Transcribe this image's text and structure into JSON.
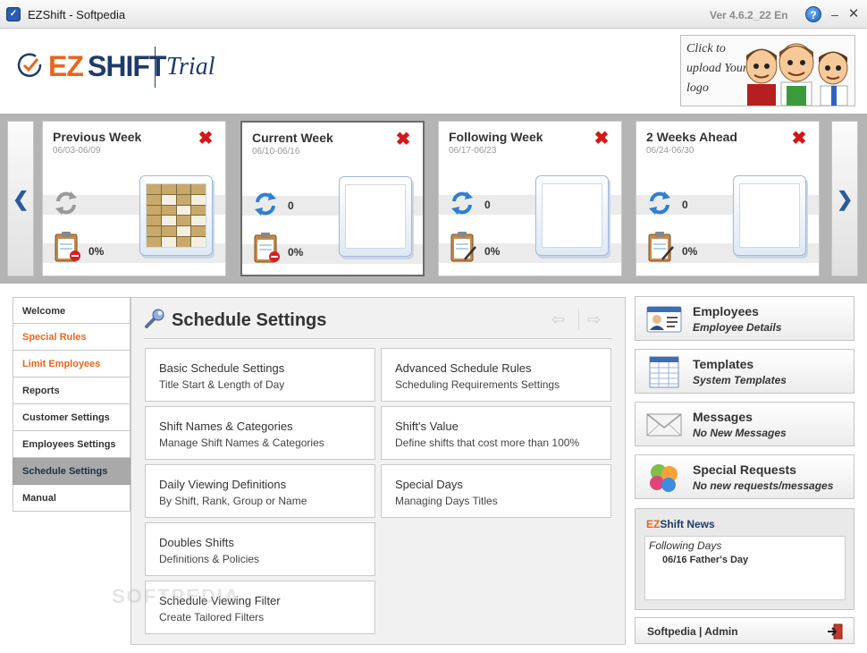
{
  "window": {
    "title": "EZShift - Softpedia",
    "version": "Ver 4.6.2_22 En",
    "help_glyph": "?",
    "minimize_glyph": "–",
    "close_glyph": "✕"
  },
  "header": {
    "logo_ez": "EZ",
    "logo_shift": "SHIFT",
    "logo_trial": "Trial",
    "upload_text": "Click to upload Your logo"
  },
  "weeks": [
    {
      "title": "Previous Week",
      "dates": "06/03-06/09",
      "count": "",
      "percent": "0%"
    },
    {
      "title": "Current Week",
      "dates": "06/10-06/16",
      "count": "0",
      "percent": "0%"
    },
    {
      "title": "Following Week",
      "dates": "06/17-06/23",
      "count": "0",
      "percent": "0%"
    },
    {
      "title": "2 Weeks Ahead",
      "dates": "06/24-06/30",
      "count": "0",
      "percent": "0%"
    }
  ],
  "week_nav": {
    "prev_glyph": "❮",
    "next_glyph": "❯"
  },
  "sidebar": {
    "items": [
      {
        "label": "Welcome"
      },
      {
        "label": "Special Rules"
      },
      {
        "label": "Limit Employees"
      },
      {
        "label": "Reports"
      },
      {
        "label": "Customer Settings"
      },
      {
        "label": "Employees Settings"
      },
      {
        "label": "Schedule Settings"
      },
      {
        "label": "Manual"
      }
    ]
  },
  "main": {
    "title": "Schedule Settings",
    "prev_glyph": "⇦",
    "next_glyph": "⇨",
    "tiles": [
      {
        "title": "Basic Schedule Settings",
        "subtitle": "Title Start & Length of Day"
      },
      {
        "title": "Advanced Schedule Rules",
        "subtitle": "Scheduling Requirements Settings"
      },
      {
        "title": "Shift Names & Categories",
        "subtitle": "Manage Shift Names & Categories"
      },
      {
        "title": "Shift's Value",
        "subtitle": "Define shifts that cost more than 100%"
      },
      {
        "title": "Daily Viewing Definitions",
        "subtitle": "By Shift, Rank, Group or Name"
      },
      {
        "title": "Special Days",
        "subtitle": "Managing Days Titles"
      },
      {
        "title": "Doubles Shifts",
        "subtitle": "Definitions & Policies"
      },
      {
        "title": "Schedule Viewing Filter",
        "subtitle": "Create Tailored Filters"
      }
    ]
  },
  "right_panel": {
    "buttons": [
      {
        "title": "Employees",
        "subtitle": "Employee Details"
      },
      {
        "title": "Templates",
        "subtitle": "System Templates"
      },
      {
        "title": "Messages",
        "subtitle": "No New Messages"
      },
      {
        "title": "Special Requests",
        "subtitle": "No new requests/messages"
      }
    ],
    "news": {
      "title_ez": "EZ",
      "title_rest": "Shift News",
      "heading": "Following Days",
      "item": "06/16 Father's Day"
    },
    "user": "Softpedia | Admin"
  },
  "watermark": "SOFTPEDIA",
  "colors": {
    "accent_orange": "#e8661d",
    "brand_navy": "#1f3b6d",
    "delete_red": "#d41717",
    "active_nav": "#a9a9a9"
  }
}
